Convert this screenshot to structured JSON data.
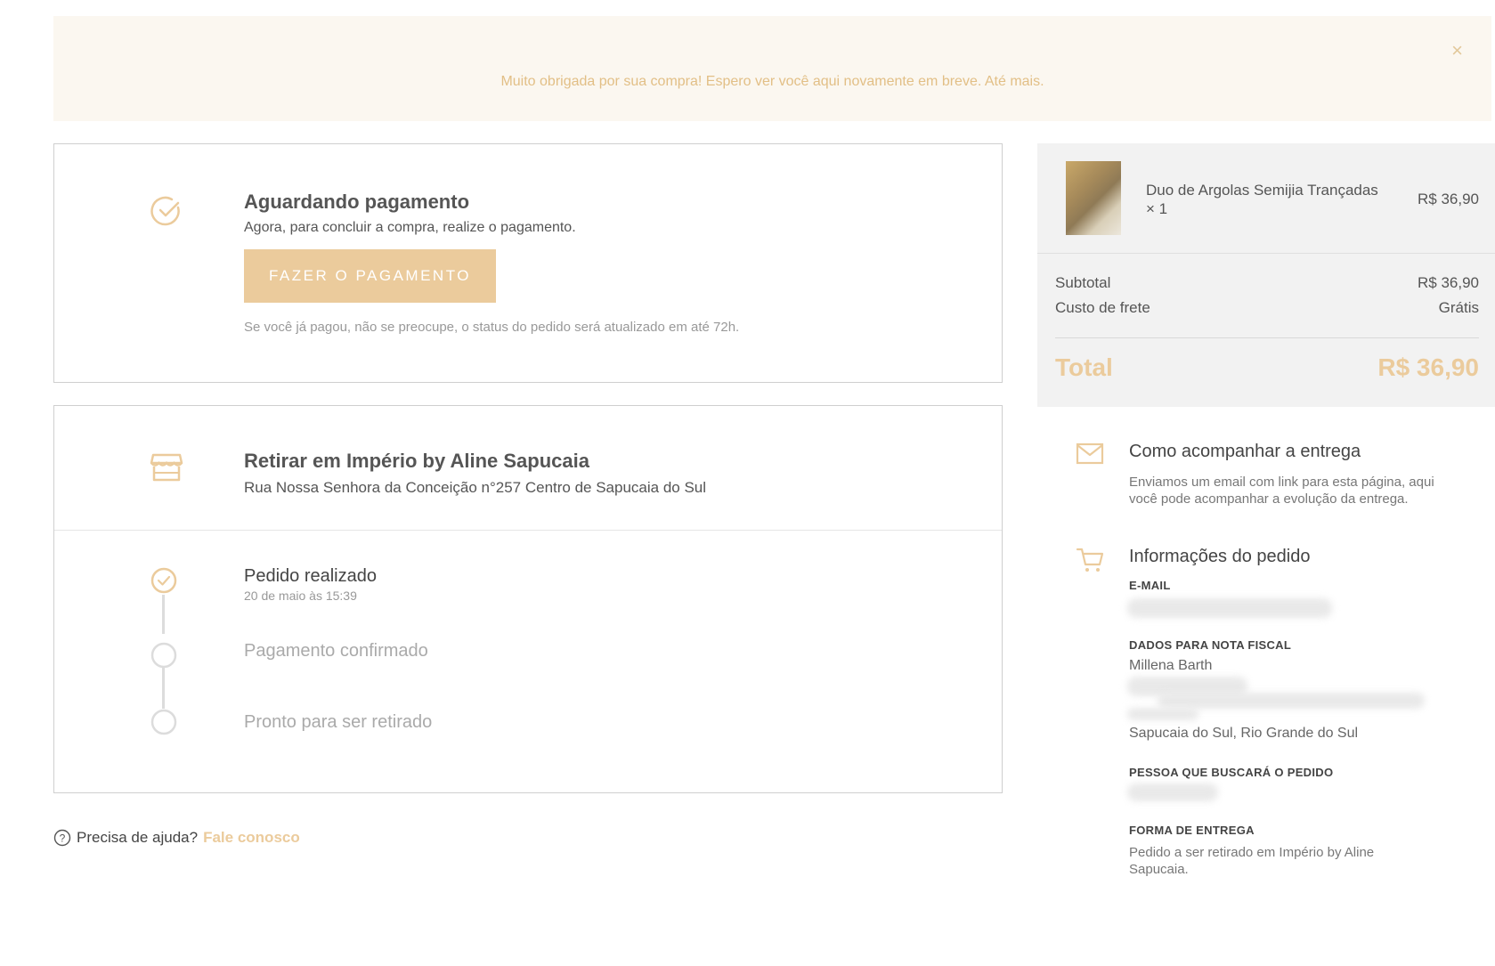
{
  "banner": {
    "message": "Muito obrigada por sua compra! Espero ver você aqui novamente em breve. Até mais.",
    "close": "×"
  },
  "payment": {
    "title": "Aguardando pagamento",
    "subtitle": "Agora, para concluir a compra, realize o pagamento.",
    "button_label": "FAZER O PAGAMENTO",
    "note": "Se você já pagou, não se preocupe, o status do pedido será atualizado em até 72h."
  },
  "pickup": {
    "title": "Retirar em Império by Aline Sapucaia",
    "address": "Rua Nossa Senhora da Conceição n°257 Centro de Sapucaia do Sul"
  },
  "steps": [
    {
      "label": "Pedido realizado",
      "date": "20 de maio às 15:39",
      "status": "done"
    },
    {
      "label": "Pagamento confirmado",
      "status": "pending"
    },
    {
      "label": "Pronto para ser retirado",
      "status": "pending"
    }
  ],
  "help": {
    "text": "Precisa de ajuda?",
    "link": "Fale conosco"
  },
  "summary": {
    "product_name": "Duo de Argolas Semijia Trançadas",
    "product_qty": "× 1",
    "product_price": "R$ 36,90",
    "subtotal_label": "Subtotal",
    "subtotal_value": "R$ 36,90",
    "shipping_label": "Custo de frete",
    "shipping_value": "Grátis",
    "total_label": "Total",
    "total_value": "R$ 36,90"
  },
  "tracking": {
    "title": "Como acompanhar a entrega",
    "text": "Enviamos um email com link para esta página, aqui você pode acompanhar a evolução da entrega."
  },
  "order_info": {
    "title": "Informações do pedido",
    "email_label": "E-MAIL",
    "invoice_label": "DADOS PARA NOTA FISCAL",
    "invoice_name": "Millena Barth",
    "invoice_city": "Sapucaia do Sul, Rio Grande do Sul",
    "pickup_person_label": "PESSOA QUE BUSCARÁ O PEDIDO",
    "delivery_label": "FORMA DE ENTREGA",
    "delivery_text": "Pedido a ser retirado em Império by Aline Sapucaia."
  },
  "colors": {
    "accent": "#ebcb9c",
    "banner_bg": "#fbf7f0",
    "summary_bg": "#f2f2f2"
  }
}
